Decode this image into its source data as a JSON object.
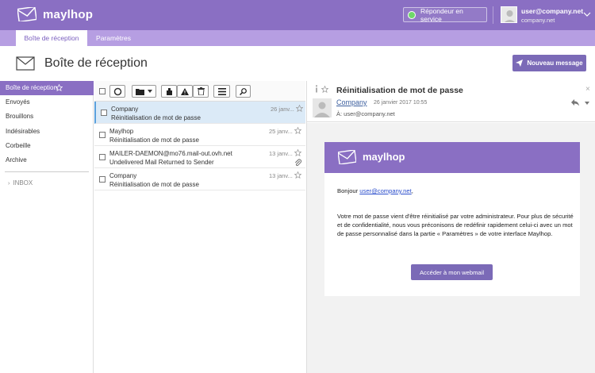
{
  "brand": {
    "name": "maylhop",
    "accent": "#8a6fc3",
    "tab_bar": "#b69ee2",
    "button": "#7b6ab7"
  },
  "header": {
    "responder_label": "Répondeur en service",
    "responder_status_color": "#6fd86a",
    "user_email": "user@company.net",
    "user_domain": "company.net"
  },
  "tabs": [
    {
      "label": "Boîte de réception",
      "active": true
    },
    {
      "label": "Paramètres",
      "active": false
    }
  ],
  "page": {
    "title": "Boîte de réception",
    "compose_label": "Nouveau message"
  },
  "sidebar": {
    "items": [
      {
        "label": "Boîte de réception",
        "active": true
      },
      {
        "label": "Envoyés"
      },
      {
        "label": "Brouillons"
      },
      {
        "label": "Indésirables"
      },
      {
        "label": "Corbeille"
      },
      {
        "label": "Archive"
      }
    ],
    "folder_label": "INBOX"
  },
  "messages": [
    {
      "from": "Company",
      "subject": "Réinitialisation de mot de passe",
      "date": "26 janv...",
      "selected": true,
      "attachment": false
    },
    {
      "from": "Maylhop",
      "subject": "Réinitialisation de mot de passe",
      "date": "25 janv...",
      "selected": false,
      "attachment": false
    },
    {
      "from": "MAILER-DAEMON@mo76.mail-out.ovh.net",
      "subject": "Undelivered Mail Returned to Sender",
      "date": "13 janv...",
      "selected": false,
      "attachment": true
    },
    {
      "from": "Company",
      "subject": "Réinitialisation de mot de passe",
      "date": "13 janv...",
      "selected": false,
      "attachment": false
    }
  ],
  "reader": {
    "subject": "Réinitialisation de mot de passe",
    "sender": "Company",
    "date": "26 janvier 2017 10:55",
    "to": "À: user@company.net",
    "close_glyph": "×",
    "email": {
      "brand": "maylhop",
      "greeting_prefix": "Bonjour ",
      "greeting_link": "user@company.net",
      "greeting_suffix": ",",
      "paragraph": "Votre mot de passe vient d'être réinitialisé par votre administrateur. Pour plus de sécurité et de confidentialité, nous vous préconisons de redéfinir rapidement celui-ci avec un mot de passe personnalisé dans la partie « Paramètres » de votre interface Maylhop.",
      "cta_label": "Accéder à mon webmail"
    }
  },
  "icons": {
    "logo": "envelope-icon",
    "toolbar": [
      "select-all-checkbox",
      "refresh-icon",
      "folder-icon",
      "archive-icon",
      "spam-warning-icon",
      "trash-icon",
      "menu-icon",
      "search-icon"
    ],
    "reader": [
      "info-icon",
      "star-icon",
      "reply-icon",
      "close-icon"
    ]
  }
}
